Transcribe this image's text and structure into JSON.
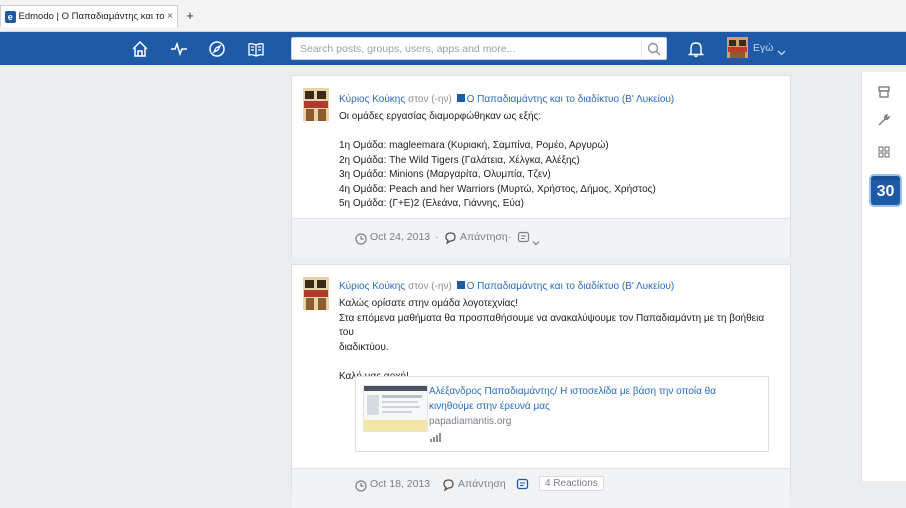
{
  "browser": {
    "tab_title": "Edmodo | Ο Παπαδιαμάντης και το δια...",
    "favicon_letter": "e",
    "tab_close": "×",
    "new_tab": "+"
  },
  "topbar": {
    "color": "#1f5aa7",
    "nav_icons": [
      "home-icon",
      "activity-icon",
      "discover-icon",
      "library-icon"
    ],
    "search_placeholder": "Search posts, groups, users, apps and more...",
    "user_label": "Εγώ"
  },
  "rail": {
    "icons": [
      "backpack-icon",
      "wrench-icon",
      "apps-grid-icon"
    ],
    "calendar_day": "30"
  },
  "posts": [
    {
      "author": "Κύριος Κούκης",
      "to_text": "στον (-ην)",
      "group": "Ο Παπαδιαμάντης και το διαδίκτυο (Β' Λυκείου)",
      "lines": [
        "Οι ομάδες εργασίας διαμορφώθηκαν ως εξής:",
        "",
        "1η Ομάδα: magleemara (Κυριακή, Σαμπίνα, Ρομέο, Αργυρώ)",
        "2η Ομάδα: The Wild Tigers (Γαλάτεια, Χέλγκα, Αλέξης)",
        "3η Ομάδα: Minions (Μαργαρίτα, Ολυμπία, Τζεν)",
        "4η Ομάδα: Peach and her Warriors (Μυρτώ, Χρήστος, Δήμος, Χρήστος)",
        "5η Ομάδα: (Γ+Ε)2 (Ελεάνα, Γιάννης, Εύα)"
      ],
      "date": "Oct 24, 2013",
      "reply": "Απάντηση",
      "dot": "·"
    },
    {
      "author": "Κύριος Κούκης",
      "to_text": "στον (-ην)",
      "group": "Ο Παπαδιαμάντης και το διαδίκτυο (Β' Λυκείου)",
      "lines": [
        "Καλώς ορίσατε στην ομάδα λογοτεχνίας!",
        "Στα επόμενα μαθήματα θα προσπαθήσουμε να ανακαλύψουμε τον Παπαδιαμάντη με τη βοήθεια του",
        "διαδικτύου.",
        "",
        "Καλή μας αρχή!"
      ],
      "link_title": "Αλέξανδρος Παπαδιαμάντης/ Η ιστοσελίδα με βάση την οποία θα κινηθούμε στην έρευνά μας",
      "link_domain": "papadiamantis.org",
      "date": "Oct 18, 2013",
      "reply": "Απάντηση",
      "reactions": "4 Reactions"
    }
  ]
}
